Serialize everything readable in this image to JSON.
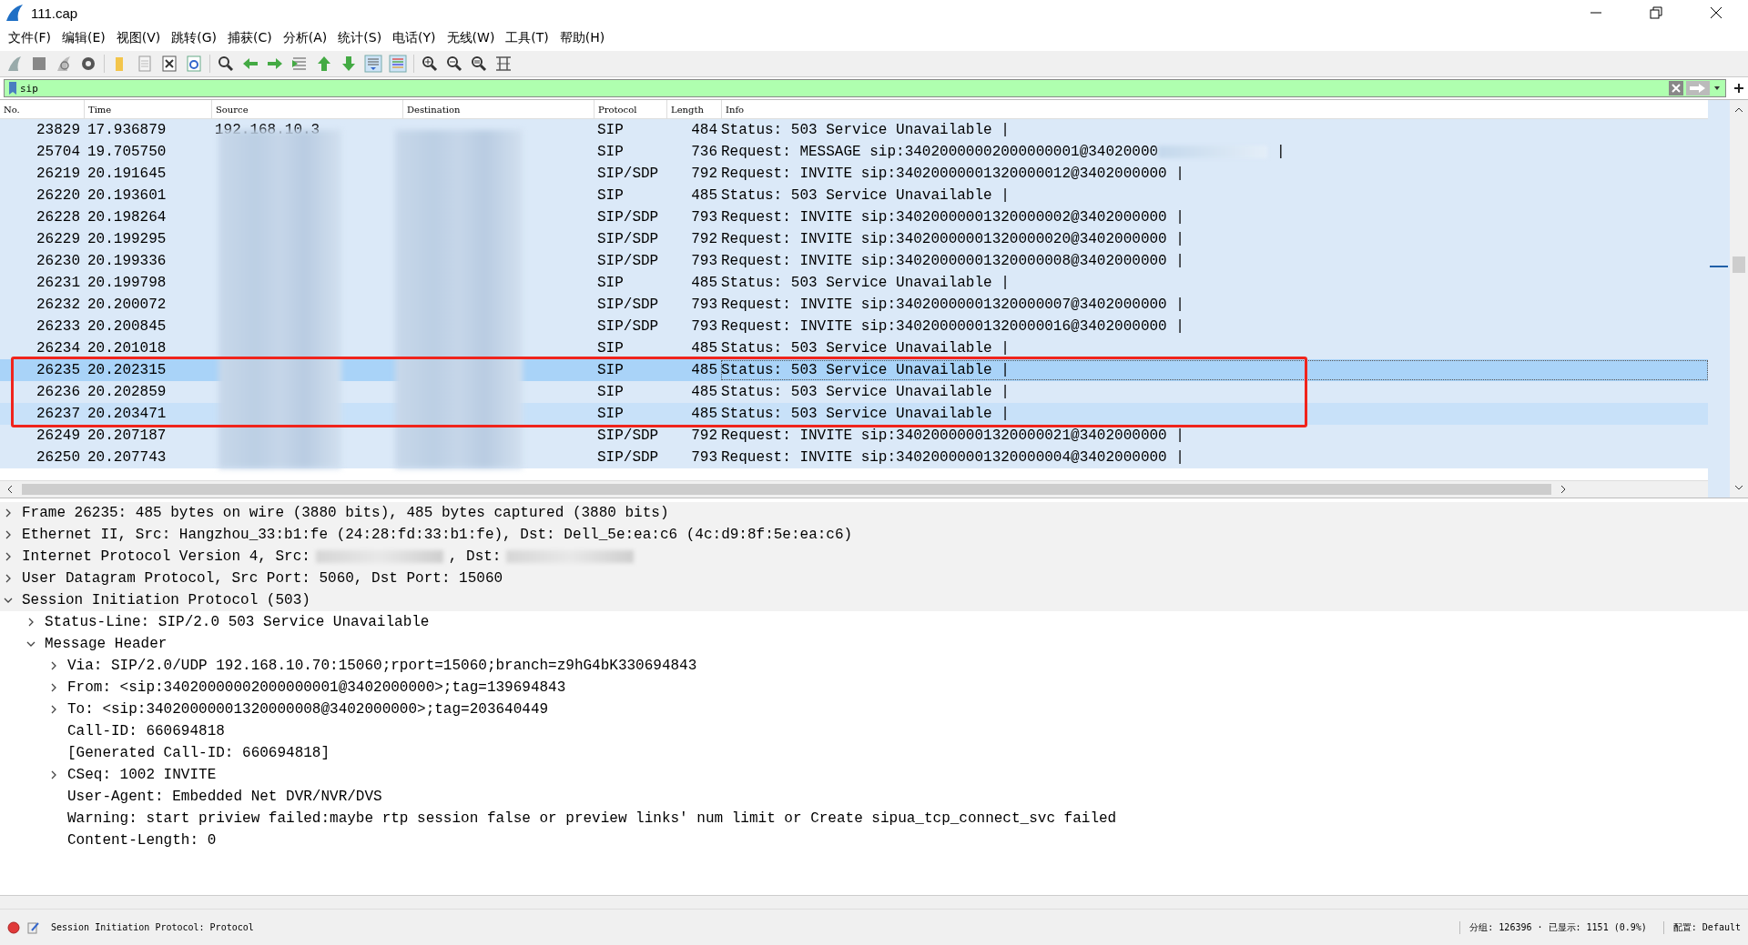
{
  "window": {
    "title": "111.cap"
  },
  "menu": [
    "文件(F)",
    "编辑(E)",
    "视图(V)",
    "跳转(G)",
    "捕获(C)",
    "分析(A)",
    "统计(S)",
    "电话(Y)",
    "无线(W)",
    "工具(T)",
    "帮助(H)"
  ],
  "filter": {
    "value": "sip"
  },
  "packets": {
    "columns": [
      "No.",
      "Time",
      "Source",
      "Destination",
      "Protocol",
      "Length",
      "Info"
    ],
    "rows": [
      {
        "kind": "plain",
        "no": "23829",
        "time": "17.936879",
        "source": "192.168.10.3",
        "protocol": "SIP",
        "length": "484",
        "info": "Status: 503 Service Unavailable |",
        "selected": false,
        "hovered": false
      },
      {
        "kind": "redacted",
        "no": "25704",
        "time": "19.705750",
        "protocol": "SIP",
        "length": "736",
        "info": "Request: MESSAGE sip:34020000002000000001@34020000",
        "info_end": "|",
        "selected": false,
        "hovered": false
      },
      {
        "kind": "plain",
        "no": "26219",
        "time": "20.191645",
        "protocol": "SIP/SDP",
        "length": "792",
        "info": "Request: INVITE sip:34020000001320000012@3402000000 |",
        "selected": false,
        "hovered": false
      },
      {
        "kind": "plain",
        "no": "26220",
        "time": "20.193601",
        "protocol": "SIP",
        "length": "485",
        "info": "Status: 503 Service Unavailable |",
        "selected": false,
        "hovered": false
      },
      {
        "kind": "plain",
        "no": "26228",
        "time": "20.198264",
        "protocol": "SIP/SDP",
        "length": "793",
        "info": "Request: INVITE sip:34020000001320000002@3402000000 |",
        "selected": false,
        "hovered": false
      },
      {
        "kind": "plain",
        "no": "26229",
        "time": "20.199295",
        "protocol": "SIP/SDP",
        "length": "792",
        "info": "Request: INVITE sip:34020000001320000020@3402000000 |",
        "selected": false,
        "hovered": false
      },
      {
        "kind": "plain",
        "no": "26230",
        "time": "20.199336",
        "protocol": "SIP/SDP",
        "length": "793",
        "info": "Request: INVITE sip:34020000001320000008@3402000000 |",
        "selected": false,
        "hovered": false
      },
      {
        "kind": "plain",
        "no": "26231",
        "time": "20.199798",
        "protocol": "SIP",
        "length": "485",
        "info": "Status: 503 Service Unavailable |",
        "selected": false,
        "hovered": false
      },
      {
        "kind": "plain",
        "no": "26232",
        "time": "20.200072",
        "protocol": "SIP/SDP",
        "length": "793",
        "info": "Request: INVITE sip:34020000001320000007@3402000000 |",
        "selected": false,
        "hovered": false
      },
      {
        "kind": "plain",
        "no": "26233",
        "time": "20.200845",
        "protocol": "SIP/SDP",
        "length": "793",
        "info": "Request: INVITE sip:34020000001320000016@3402000000 |",
        "selected": false,
        "hovered": false
      },
      {
        "kind": "plain",
        "no": "26234",
        "time": "20.201018",
        "protocol": "SIP",
        "length": "485",
        "info": "Status: 503 Service Unavailable |",
        "selected": false,
        "hovered": false
      },
      {
        "kind": "plain",
        "no": "26235",
        "time": "20.202315",
        "protocol": "SIP",
        "length": "485",
        "info": "Status: 503 Service Unavailable |",
        "selected": true,
        "hovered": false
      },
      {
        "kind": "plain",
        "no": "26236",
        "time": "20.202859",
        "protocol": "SIP",
        "length": "485",
        "info": "Status: 503 Service Unavailable |",
        "selected": false,
        "hovered": false
      },
      {
        "kind": "plain",
        "no": "26237",
        "time": "20.203471",
        "protocol": "SIP",
        "length": "485",
        "info": "Status: 503 Service Unavailable |",
        "selected": false,
        "hovered": true
      },
      {
        "kind": "plain",
        "no": "26249",
        "time": "20.207187",
        "protocol": "SIP/SDP",
        "length": "792",
        "info": "Request: INVITE sip:34020000001320000021@3402000000 |",
        "selected": false,
        "hovered": false
      },
      {
        "kind": "plain",
        "no": "26250",
        "time": "20.207743",
        "protocol": "SIP/SDP",
        "length": "793",
        "info": "Request: INVITE sip:34020000001320000004@3402000000 |",
        "selected": false,
        "hovered": false
      }
    ]
  },
  "details": [
    {
      "kind": "plain",
      "text": "Frame 26235: 485 bytes on wire (3880 bits), 485 bytes captured (3880 bits)",
      "expanded": false
    },
    {
      "kind": "plain",
      "text": "Ethernet II, Src: Hangzhou_33:b1:fe (24:28:fd:33:b1:fe), Dst: Dell_5e:ea:c6 (4c:d9:8f:5e:ea:c6)",
      "expanded": false
    },
    {
      "kind": "redacted",
      "text": "Internet Protocol Version 4, Src:",
      "text_after": ", Dst:",
      "expanded": false
    },
    {
      "kind": "plain",
      "text": "User Datagram Protocol, Src Port: 5060, Dst Port: 15060",
      "expanded": false
    },
    {
      "kind": "plain",
      "text": "Session Initiation Protocol (503)",
      "expanded": true,
      "children": [
        {
          "text": "Status-Line: SIP/2.0 503 Service Unavailable",
          "expanded": false
        },
        {
          "text": "Message Header",
          "expanded": true,
          "children": [
            {
              "text": "Via: SIP/2.0/UDP 192.168.10.70:15060;rport=15060;branch=z9hG4bK330694843",
              "expanded": false
            },
            {
              "text": "From: <sip:34020000002000000001@3402000000>;tag=139694843",
              "expanded": false
            },
            {
              "text": "To: <sip:34020000001320000008@3402000000>;tag=203640449",
              "expanded": false
            },
            {
              "text": "Call-ID: 660694818"
            },
            {
              "text": "[Generated Call-ID: 660694818]"
            },
            {
              "text": "CSeq: 1002 INVITE",
              "expanded": false
            },
            {
              "text": "User-Agent: Embedded Net DVR/NVR/DVS"
            },
            {
              "text": "Warning: start priview failed:maybe rtp session false or preview links' num limit or Create sipua_tcp_connect_svc failed"
            },
            {
              "text": "Content-Length: 0"
            }
          ]
        }
      ]
    }
  ],
  "status_bar": {
    "message": "Session Initiation Protocol: Protocol",
    "counts": "分组: 126396 · 已显示: 1151 (0.9%)",
    "profile": "配置: Default"
  }
}
